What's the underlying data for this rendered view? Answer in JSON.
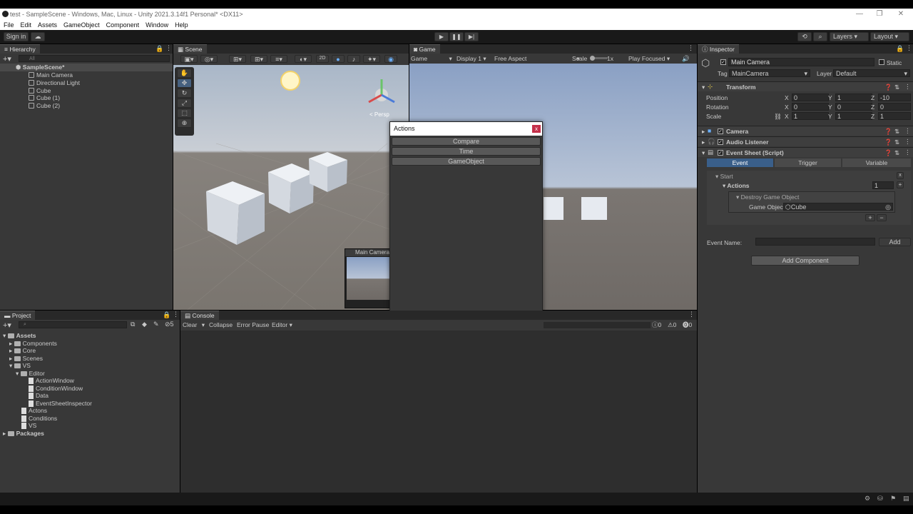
{
  "window": {
    "title": "test - SampleScene - Windows, Mac, Linux - Unity 2021.3.14f1 Personal* <DX11>"
  },
  "menu": [
    "File",
    "Edit",
    "Assets",
    "GameObject",
    "Component",
    "Window",
    "Help"
  ],
  "toolbar": {
    "sign_in": "Sign in",
    "layers": "Layers",
    "layout": "Layout"
  },
  "hierarchy": {
    "tab": "Hierarchy",
    "search_placeholder": "All",
    "scene": "SampleScene*",
    "items": [
      "Main Camera",
      "Directional Light",
      "Cube",
      "Cube (1)",
      "Cube (2)"
    ]
  },
  "scene_view": {
    "tab": "Scene",
    "mode_2d": "2D",
    "persp": "< Persp",
    "camera_preview": "Main Camera"
  },
  "game_view": {
    "tab": "Game",
    "display_mode": "Game",
    "display": "Display 1",
    "aspect": "Free Aspect",
    "scale_label": "Scale",
    "scale_value": "1x",
    "play_focused": "Play Focused"
  },
  "actions_window": {
    "title": "Actions",
    "close": "x",
    "buttons": [
      "Compare",
      "Time",
      "GameObject"
    ]
  },
  "inspector": {
    "tab": "Inspector",
    "object_name": "Main Camera",
    "static": "Static",
    "tag_label": "Tag",
    "tag_value": "MainCamera",
    "layer_label": "Layer",
    "layer_value": "Default",
    "transform": {
      "title": "Transform",
      "rows": [
        {
          "label": "Position",
          "x": "0",
          "y": "1",
          "z": "-10"
        },
        {
          "label": "Rotation",
          "x": "0",
          "y": "0",
          "z": "0"
        },
        {
          "label": "Scale",
          "x": "1",
          "y": "1",
          "z": "1"
        }
      ]
    },
    "components": [
      "Camera",
      "Audio Listener",
      "Event Sheet (Script)"
    ],
    "event_tabs": [
      "Event",
      "Trigger",
      "Variable"
    ],
    "event_tree": {
      "start": "Start",
      "actions_label": "Actions",
      "actions_count": "1",
      "destroy": "Destroy Game Object",
      "go_label": "Game Objec",
      "go_value": "Cube",
      "remove": "x",
      "add": "+",
      "plus": "+",
      "minus": "−"
    },
    "event_name_label": "Event Name:",
    "add_button": "Add",
    "add_component": "Add Component"
  },
  "project": {
    "tab": "Project",
    "badge": "5",
    "items": [
      {
        "name": "Assets",
        "depth": 0,
        "type": "folder",
        "bold": true
      },
      {
        "name": "Components",
        "depth": 1,
        "type": "folder"
      },
      {
        "name": "Core",
        "depth": 1,
        "type": "folder"
      },
      {
        "name": "Scenes",
        "depth": 1,
        "type": "folder"
      },
      {
        "name": "VS",
        "depth": 1,
        "type": "folder"
      },
      {
        "name": "Editor",
        "depth": 2,
        "type": "folder"
      },
      {
        "name": "ActionWindow",
        "depth": 3,
        "type": "file"
      },
      {
        "name": "ConditionWindow",
        "depth": 3,
        "type": "file"
      },
      {
        "name": "Data",
        "depth": 3,
        "type": "file"
      },
      {
        "name": "EventSheetInspector",
        "depth": 3,
        "type": "file"
      },
      {
        "name": "Actons",
        "depth": 2,
        "type": "file"
      },
      {
        "name": "Conditions",
        "depth": 2,
        "type": "file"
      },
      {
        "name": "VS",
        "depth": 2,
        "type": "file"
      },
      {
        "name": "Packages",
        "depth": 0,
        "type": "folder",
        "bold": true
      }
    ]
  },
  "console": {
    "tab": "Console",
    "clear": "Clear",
    "collapse": "Collapse",
    "error_pause": "Error Pause",
    "editor": "Editor",
    "counts": [
      "0",
      "0",
      "0"
    ]
  },
  "colors": {
    "accent": "#3a5f8a",
    "panel": "#383838",
    "background": "#282828",
    "close_red": "#c4304a"
  }
}
